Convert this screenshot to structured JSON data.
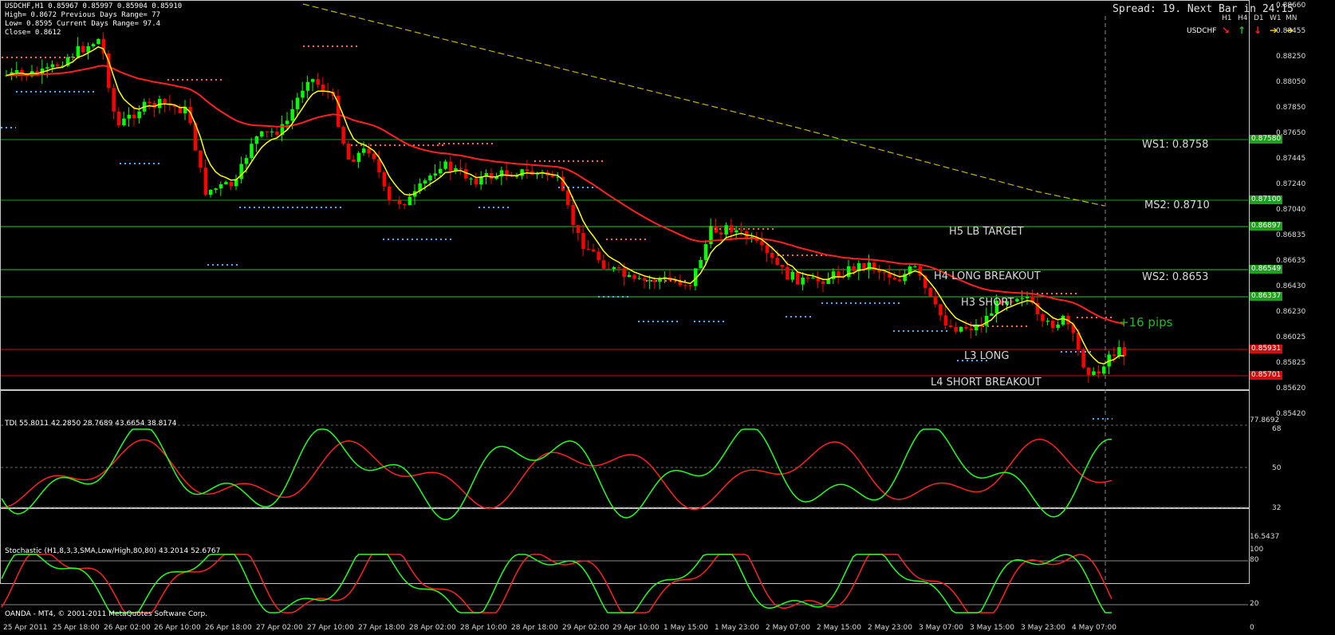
{
  "header": {
    "symbol_line": "USDCHF,H1  0.85967 0.85997 0.85904 0.85910",
    "high_line": "High= 0.8672     Previous Days Range= 77",
    "low_line": "Low= 0.8595    Current Days Range= 97.4",
    "close_line": "Close= 0.8612"
  },
  "spread_line": "Spread: 19. Next Bar in 24:15",
  "tf_labels": [
    "H1",
    "H4",
    "D1",
    "W1",
    "MN"
  ],
  "tf_symbol": "USDCHF",
  "tf_colors": [
    "#ff2020",
    "#20c020",
    "#ff2020",
    "#ffd000",
    "#ffd000"
  ],
  "pivot_labels": {
    "ws1": "WS1:  0.8758",
    "ms2": "MS2:  0.8710",
    "ws2": "WS2:  0.8653",
    "h5": "H5 LB TARGET",
    "h4": "H4 LONG BREAKOUT",
    "h3": "H3 SHORT",
    "l3": "L3 LONG",
    "l4": "L4 SHORT BREAKOUT",
    "pips": "+16 pips"
  },
  "price_axis": [
    "0.88660",
    "0.88455",
    "0.88250",
    "0.88050",
    "0.87850",
    "0.87650",
    "0.87445",
    "0.87240",
    "0.87040",
    "0.86835",
    "0.86635",
    "0.86430",
    "0.86230",
    "0.86025",
    "0.85825",
    "0.85620",
    "0.85420"
  ],
  "price_tags": [
    {
      "text": "0.87580",
      "color": "#20a020"
    },
    {
      "text": "0.87100",
      "color": "#20a020"
    },
    {
      "text": "0.86897",
      "color": "#20a020"
    },
    {
      "text": "0.86549",
      "color": "#20a020"
    },
    {
      "text": "0.86337",
      "color": "#20a020"
    },
    {
      "text": "0.85931",
      "color": "#d01010"
    },
    {
      "text": "0.85701",
      "color": "#d01010"
    }
  ],
  "tdi": {
    "label": "TDI 55.8011 42.2850 28.7689 43.6654 38.8174",
    "axis": [
      "77.8692",
      "68",
      "50",
      "32",
      "16.5437"
    ]
  },
  "stoch": {
    "label": "Stochastic (H1,8,3,3,SMA,Low/High,80,80) 43.2014 52.6767",
    "axis": [
      "100",
      "80",
      "20",
      "0"
    ]
  },
  "copyright": "OANDA - MT4, © 2001-2011 MetaQuotes Software Corp.",
  "time_axis": [
    "25 Apr 2011",
    "25 Apr 18:00",
    "26 Apr 02:00",
    "26 Apr 10:00",
    "26 Apr 18:00",
    "27 Apr 02:00",
    "27 Apr 10:00",
    "27 Apr 18:00",
    "28 Apr 02:00",
    "28 Apr 10:00",
    "28 Apr 18:00",
    "29 Apr 02:00",
    "29 Apr 10:00",
    "1 May 15:00",
    "1 May 23:00",
    "2 May 07:00",
    "2 May 15:00",
    "2 May 23:00",
    "3 May 07:00",
    "3 May 15:00",
    "3 May 23:00",
    "4 May 07:00"
  ],
  "colors": {
    "bull": "#00ff00",
    "bear": "#ff0000",
    "fast_ma": "#ffff00",
    "slow_ma": "#ff2020",
    "pivot_green": "#19a019",
    "pivot_red": "#c01010"
  }
}
